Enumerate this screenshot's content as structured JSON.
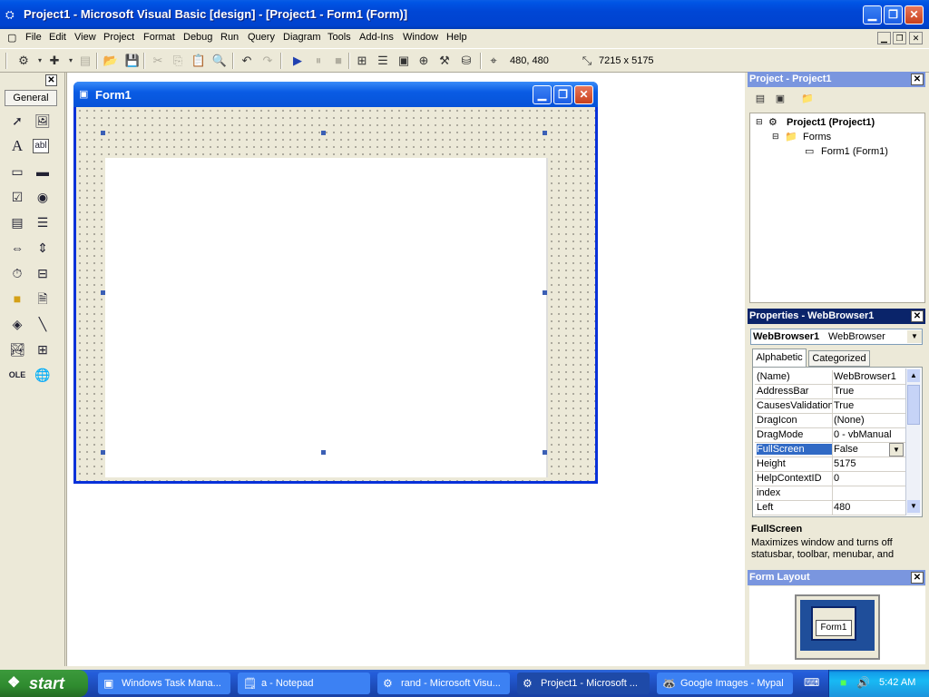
{
  "window": {
    "title": "Project1 - Microsoft Visual Basic [design] - [Project1 - Form1 (Form)]"
  },
  "menu": [
    "File",
    "Edit",
    "View",
    "Project",
    "Format",
    "Debug",
    "Run",
    "Query",
    "Diagram",
    "Tools",
    "Add-Ins",
    "Window",
    "Help"
  ],
  "toolbar": {
    "position": "480, 480",
    "size": "7215 x 5175"
  },
  "toolbox": {
    "tab": "General"
  },
  "form": {
    "title": "Form1"
  },
  "project_panel": {
    "title": "Project - Project1",
    "root": "Project1 (Project1)",
    "folder": "Forms",
    "item": "Form1 (Form1)"
  },
  "properties_panel": {
    "title": "Properties - WebBrowser1",
    "object_name": "WebBrowser1",
    "object_type": "WebBrowser",
    "tabs": [
      "Alphabetic",
      "Categorized"
    ],
    "rows": [
      {
        "name": "(Name)",
        "value": "WebBrowser1"
      },
      {
        "name": "AddressBar",
        "value": "True"
      },
      {
        "name": "CausesValidation",
        "value": "True"
      },
      {
        "name": "DragIcon",
        "value": "(None)"
      },
      {
        "name": "DragMode",
        "value": "0 - vbManual"
      },
      {
        "name": "FullScreen",
        "value": "False"
      },
      {
        "name": "Height",
        "value": "5175"
      },
      {
        "name": "HelpContextID",
        "value": "0"
      },
      {
        "name": "index",
        "value": ""
      },
      {
        "name": "Left",
        "value": "480"
      }
    ],
    "desc_title": "FullScreen",
    "desc_text": "Maximizes window and turns off statusbar, toolbar, menubar, and"
  },
  "layout_panel": {
    "title": "Form Layout",
    "preview_label": "Form1"
  },
  "taskbar": {
    "start": "start",
    "tasks": [
      "Windows Task Mana...",
      "a - Notepad",
      "rand - Microsoft Visu...",
      "Project1 - Microsoft ...",
      "Google Images - Mypal"
    ],
    "clock": "5:42 AM"
  }
}
